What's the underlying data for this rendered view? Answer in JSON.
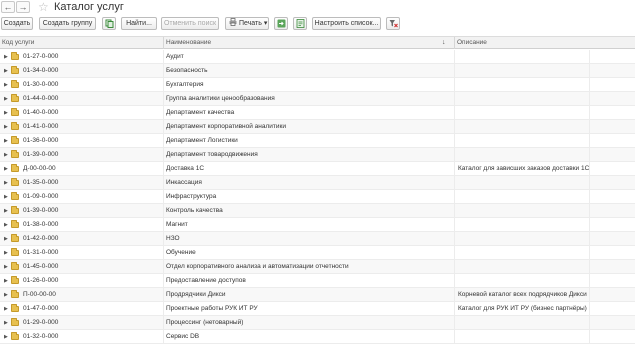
{
  "window": {
    "title": "Каталог услуг",
    "nav_back": "←",
    "nav_forward": "→",
    "favorite_icon": "☆"
  },
  "toolbar": {
    "create": "Создать",
    "create_group": "Создать группу",
    "find": "Найти...",
    "cancel_search": "Отменить поиск",
    "print": "Печать",
    "print_arrow": "▾",
    "configure_list": "Настроить список..."
  },
  "columns": {
    "code": "Код услуги",
    "name": "Наименование",
    "description": "Описание",
    "sort_indicator": "↓"
  },
  "rows": [
    {
      "code": "01-27-0-000",
      "name": "Аудит",
      "description": ""
    },
    {
      "code": "01-34-0-000",
      "name": "Безопасность",
      "description": ""
    },
    {
      "code": "01-30-0-000",
      "name": "Бухгалтерия",
      "description": ""
    },
    {
      "code": "01-44-0-000",
      "name": "Группа аналитики ценообразования",
      "description": ""
    },
    {
      "code": "01-40-0-000",
      "name": "Департамент качества",
      "description": ""
    },
    {
      "code": "01-41-0-000",
      "name": "Департамент корпоративной аналитики",
      "description": ""
    },
    {
      "code": "01-36-0-000",
      "name": "Департамент Логистики",
      "description": ""
    },
    {
      "code": "01-39-0-000",
      "name": "Департамент товародвижения",
      "description": ""
    },
    {
      "code": "Д-00-00-00",
      "name": "Доставка 1С",
      "description": "Каталог для зависших заказов доставки 1С"
    },
    {
      "code": "01-35-0-000",
      "name": "Инкассация",
      "description": ""
    },
    {
      "code": "01-09-0-000",
      "name": "Инфраструктура",
      "description": ""
    },
    {
      "code": "01-39-0-000",
      "name": "Контроль качества",
      "description": ""
    },
    {
      "code": "01-38-0-000",
      "name": "Магнит",
      "description": ""
    },
    {
      "code": "01-42-0-000",
      "name": "НЗО",
      "description": ""
    },
    {
      "code": "01-31-0-000",
      "name": "Обучение",
      "description": ""
    },
    {
      "code": "01-45-0-000",
      "name": "Отдел корпоративного анализа и автоматизации отчетности",
      "description": ""
    },
    {
      "code": "01-26-0-000",
      "name": "Предоставление доступов",
      "description": ""
    },
    {
      "code": "П-00-00-00",
      "name": "Продрядчики Дикси",
      "description": "Корневой каталог всех подрядчиков Дикси"
    },
    {
      "code": "01-47-0-000",
      "name": "Проектные работы РУК ИТ РУ",
      "description": "Каталог для РУК ИТ РУ (бизнес партнёры)"
    },
    {
      "code": "01-29-0-000",
      "name": "Процессинг (нетоварный)",
      "description": ""
    },
    {
      "code": "01-32-0-000",
      "name": "Сервис DB",
      "description": ""
    }
  ]
}
